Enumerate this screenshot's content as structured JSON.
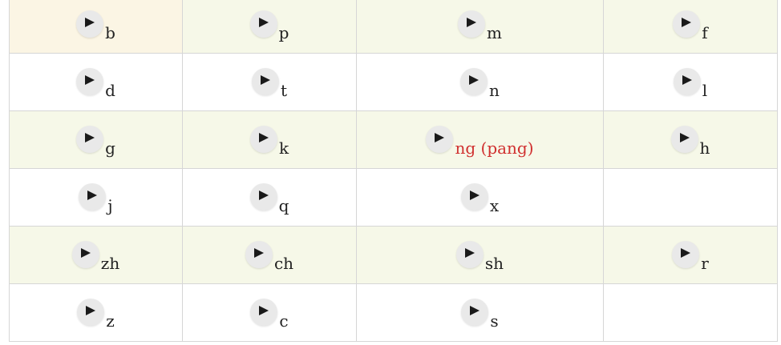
{
  "accent_red": "#d0302f",
  "play_icon": "play-icon",
  "rows": [
    [
      "b",
      "p",
      "m",
      "f"
    ],
    [
      "d",
      "t",
      "n",
      "l"
    ],
    [
      "g",
      "k",
      "ng (pang)",
      "h"
    ],
    [
      "j",
      "q",
      "x",
      ""
    ],
    [
      "zh",
      "ch",
      "sh",
      "r"
    ],
    [
      "z",
      "c",
      "s",
      ""
    ]
  ]
}
